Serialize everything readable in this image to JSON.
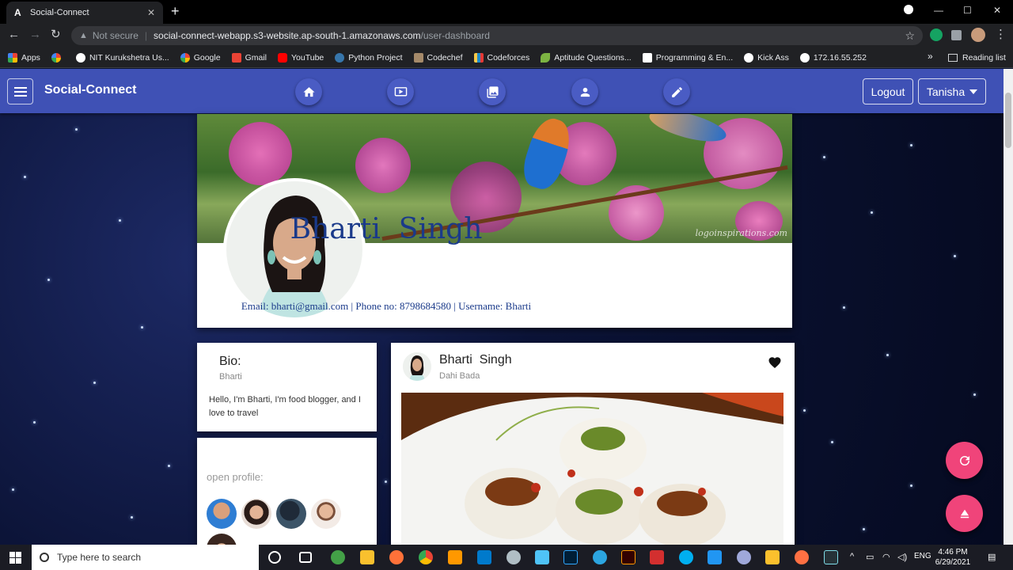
{
  "browser": {
    "tab_title": "Social-Connect",
    "tab_favicon": "A",
    "url_warning": "Not secure",
    "url_host": "social-connect-webapp.s3-website.ap-south-1.amazonaws.com",
    "url_path": "/user-dashboard",
    "bookmarks": [
      {
        "label": "Apps",
        "icon_color": "#e94235"
      },
      {
        "label": "",
        "icon_color": "#4285f4"
      },
      {
        "label": "NIT Kurukshetra Us...",
        "icon_color": "#ffffff"
      },
      {
        "label": "Google",
        "icon_color": "#34a853"
      },
      {
        "label": "Gmail",
        "icon_color": "#ea4335"
      },
      {
        "label": "YouTube",
        "icon_color": "#ff0000"
      },
      {
        "label": "Python Project",
        "icon_color": "#3776ab"
      },
      {
        "label": "Codechef",
        "icon_color": "#a58a6a"
      },
      {
        "label": "Codeforces",
        "icon_color": "#1f8acb"
      },
      {
        "label": "Aptitude Questions...",
        "icon_color": "#7cb342"
      },
      {
        "label": "Programming & En...",
        "icon_color": "#ffffff"
      },
      {
        "label": "Kick Ass",
        "icon_color": "#ffffff"
      },
      {
        "label": "172.16.55.252",
        "icon_color": "#ffffff"
      }
    ],
    "more_bookmarks": "»",
    "reading_list": "Reading list"
  },
  "app": {
    "brand": "Social-Connect",
    "logout_label": "Logout",
    "user_menu_label": "Tanisha",
    "accent": "#3f51b5"
  },
  "profile": {
    "name": "Bharti  Singh",
    "meta": "Email: bharti@gmail.com | Phone no: 8798684580 | Username: Bharti",
    "cover_watermark": "logoinspirations.com"
  },
  "bio": {
    "title": "Bio:",
    "username": "Bharti",
    "text": "Hello, I'm Bharti, I'm food blogger, and I love to travel"
  },
  "open_profile": {
    "title": "open profile:"
  },
  "post": {
    "author": "Bharti  Singh",
    "caption": "Dahi Bada"
  },
  "taskbar": {
    "search_placeholder": "Type here to search",
    "lang": "ENG",
    "time": "4:46 PM",
    "date": "6/29/2021"
  }
}
